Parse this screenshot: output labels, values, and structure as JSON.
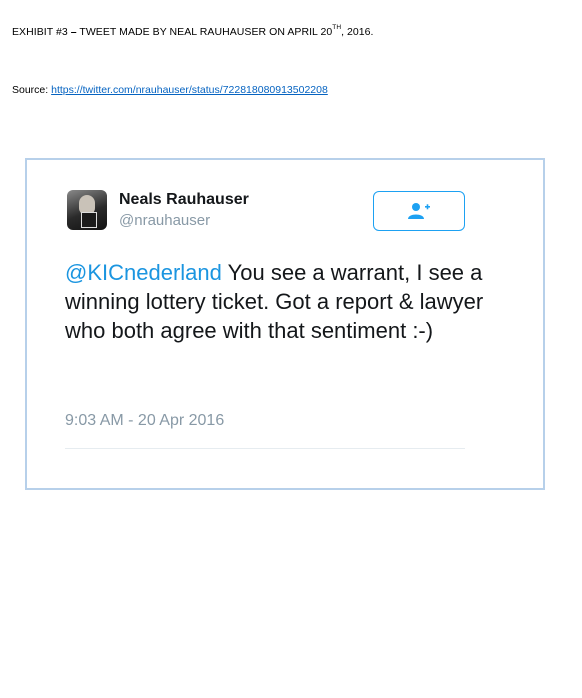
{
  "exhibit": {
    "heading_prefix": "EXHIBIT #3",
    "heading_dash": "–",
    "heading_main": " TWEET MADE BY NEAL RAUHAUSER ON APRIL 20",
    "heading_sup": "TH",
    "heading_suffix": ", 2016.",
    "source_label": "Source: ",
    "source_url": "https://twitter.com/nrauhauser/status/722818080913502208"
  },
  "tweet": {
    "author_name": "Neals Rauhauser",
    "author_handle": "@nrauhauser",
    "mention": "@KICnederland",
    "body": " You see a warrant, I see a winning lottery ticket. Got a report & lawyer who both agree with that sentiment :-)",
    "timestamp": "9:03 AM - 20 Apr 2016",
    "follow_icon": "add-user-icon"
  },
  "colors": {
    "link": "#0563c1",
    "twitter_blue": "#1da1f2",
    "mention": "#1b95e0",
    "frame_border": "#b7d0ea",
    "muted": "#8899a6"
  }
}
